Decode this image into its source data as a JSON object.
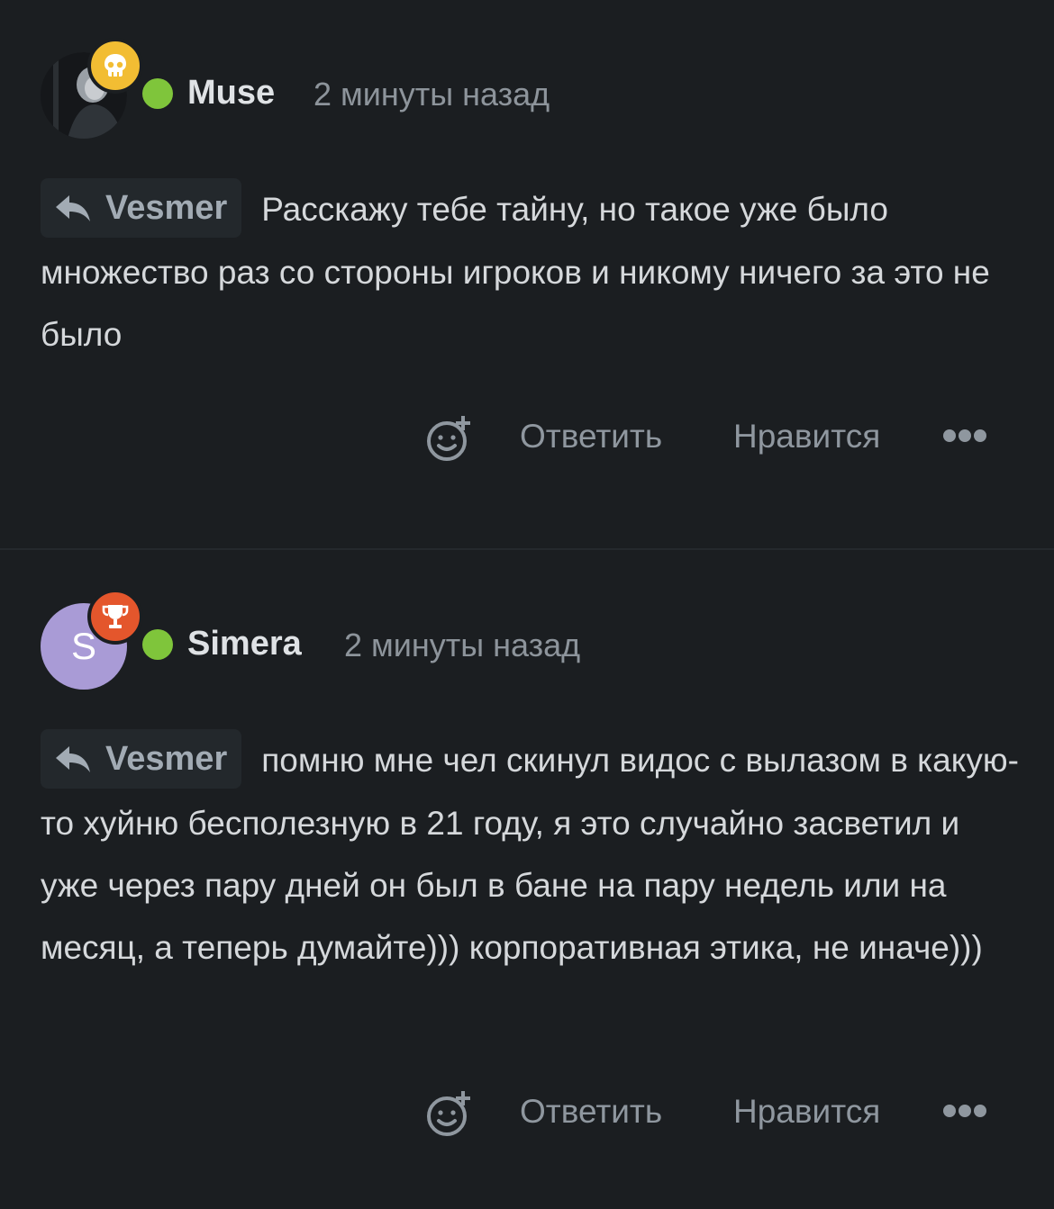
{
  "comments": [
    {
      "author": "Muse",
      "time": "2 минуты назад",
      "avatar": "photo",
      "badge_icon": "skull-icon",
      "reply_to": "Vesmer",
      "text": "Расскажу тебе тайну, но такое уже было множество раз со стороны игроков и никому ничего за это не было",
      "reply_label": "Ответить",
      "like_label": "Нравится"
    },
    {
      "author": "Simera",
      "time": "2 минуты назад",
      "avatar_letter": "S",
      "badge_icon": "trophy-icon",
      "reply_to": "Vesmer",
      "text": "помню мне чел скинул видос с вылазом в какую-то хуйню бесполезную в 21 году, я это случайно засветил и уже через пару дней он был в бане на пару недель или на месяц, а теперь думайте))) корпоративная этика, не иначе)))",
      "reply_label": "Ответить",
      "like_label": "Нравится"
    }
  ],
  "colors": {
    "background": "#1b1e21",
    "online": "#7fc53b",
    "badge_skull": "#f2bd33",
    "badge_trophy": "#e4562c",
    "avatar_letter_bg": "#a99bd6",
    "muted_text": "#8f979f"
  }
}
